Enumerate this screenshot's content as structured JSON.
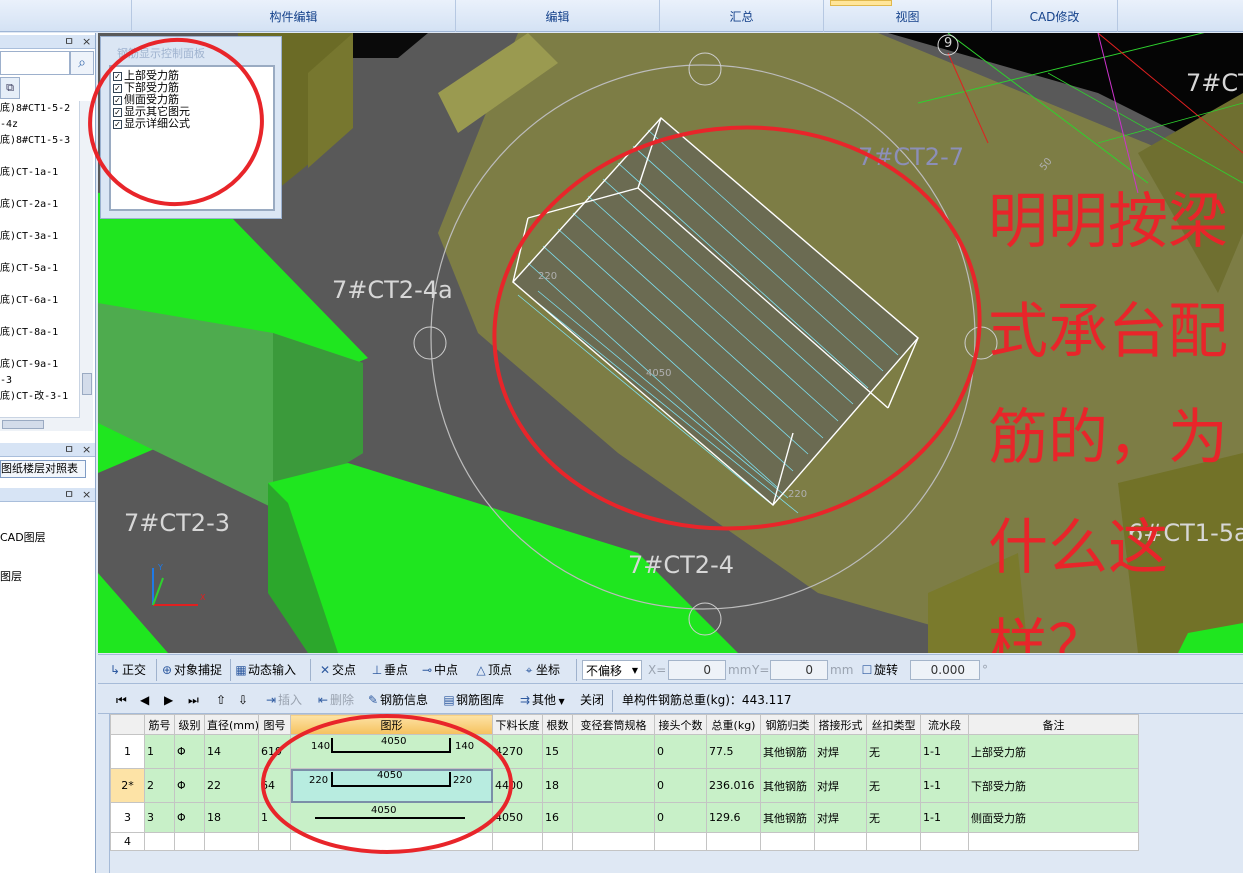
{
  "ribbon": {
    "groups": [
      "构件编辑",
      "编辑",
      "汇总",
      "视图",
      "CAD修改"
    ]
  },
  "left_panel": {
    "dock_pin": "ㅁ",
    "dock_close": "×",
    "tree_items": [
      "底)8#CT1-5-2",
      "-4z",
      "底)8#CT1-5-3",
      "",
      "底)CT-1a-1",
      "",
      "底)CT-2a-1",
      "",
      "底)CT-3a-1",
      "",
      "底)CT-5a-1",
      "",
      "底)CT-6a-1",
      "",
      "底)CT-8a-1",
      "",
      "底)CT-9a-1",
      "-3",
      "底)CT-改-3-1"
    ],
    "compare_tab": "图纸楼层对照表",
    "layers": [
      "CAD图层",
      "图层"
    ]
  },
  "rebar_panel": {
    "title": "钢筋显示控制面板",
    "options": [
      {
        "label": "上部受力筋",
        "checked": true
      },
      {
        "label": "下部受力筋",
        "checked": true
      },
      {
        "label": "侧面受力筋",
        "checked": true
      },
      {
        "label": "显示其它图元",
        "checked": true
      },
      {
        "label": "显示详细公式",
        "checked": true
      }
    ]
  },
  "viewport": {
    "labels": {
      "ct2_4a": "7#CT2-4a",
      "ct2_7": "7#CT2-7",
      "ct2_3": "7#CT2-3",
      "ct2_4": "7#CT2-4",
      "ct1_5a": "6#CT1-5a",
      "ct_top": "7#CT",
      "axis_9": "9",
      "dim_220a": "220",
      "dim_4050": "4050",
      "dim_220b": "220",
      "dim_50": "50"
    },
    "annotation_lines": [
      "明明按梁",
      "式承台配",
      "筋的，为",
      "什么这",
      "样？"
    ],
    "axis_labels": {
      "x": "X",
      "y": "Y"
    }
  },
  "snap_toolbar": {
    "ortho": "正交",
    "snap": "对象捕捉",
    "dynamic": "动态输入",
    "intersect": "交点",
    "perp": "垂点",
    "mid": "中点",
    "vertex": "顶点",
    "coord": "坐标",
    "offset_select": "不偏移",
    "x_label": "X=",
    "x_value": "0",
    "y_label": "Y=",
    "y_value": "0",
    "unit": "mm",
    "rotate": "旋转",
    "rotate_value": "0.000",
    "degree": "°"
  },
  "grid_toolbar": {
    "insert": "插入",
    "delete": "删除",
    "rebar_info": "钢筋信息",
    "rebar_lib": "钢筋图库",
    "other": "其他",
    "close": "关闭",
    "total_label": "单构件钢筋总重(kg)：443.117"
  },
  "table": {
    "headers": [
      "",
      "筋号",
      "级别",
      "直径(mm)",
      "图号",
      "图形",
      "下料长度",
      "根数",
      "变径套筒规格",
      "接头个数",
      "总重(kg)",
      "钢筋归类",
      "搭接形式",
      "丝扣类型",
      "流水段",
      "备注"
    ],
    "rows": [
      {
        "rn": "1",
        "no": "1",
        "grade": "Φ",
        "dia": "14",
        "fig": "619",
        "left": "140",
        "mid": "4050",
        "right": "140",
        "len": "4270",
        "count": "15",
        "sleeve": "",
        "joints": "0",
        "weight": "77.5",
        "cls": "其他钢筋",
        "lap": "对焊",
        "thread": "无",
        "seg": "1-1",
        "note": "上部受力筋"
      },
      {
        "rn": "2*",
        "no": "2",
        "grade": "Φ",
        "dia": "22",
        "fig": "64",
        "left": "220",
        "mid": "4050",
        "right": "220",
        "len": "4400",
        "count": "18",
        "sleeve": "",
        "joints": "0",
        "weight": "236.016",
        "cls": "其他钢筋",
        "lap": "对焊",
        "thread": "无",
        "seg": "1-1",
        "note": "下部受力筋"
      },
      {
        "rn": "3",
        "no": "3",
        "grade": "Φ",
        "dia": "18",
        "fig": "1",
        "left": "",
        "mid": "4050",
        "right": "",
        "len": "4050",
        "count": "16",
        "sleeve": "",
        "joints": "0",
        "weight": "129.6",
        "cls": "其他钢筋",
        "lap": "对焊",
        "thread": "无",
        "seg": "1-1",
        "note": "侧面受力筋"
      }
    ],
    "blank_row": "4"
  },
  "colors": {
    "annotation_red": "#e8252a",
    "slab_green": "#1fe61f",
    "olive": "#8a8a3a",
    "rebar_cyan": "#7fe0ef",
    "row_green": "#c8f0c8"
  }
}
